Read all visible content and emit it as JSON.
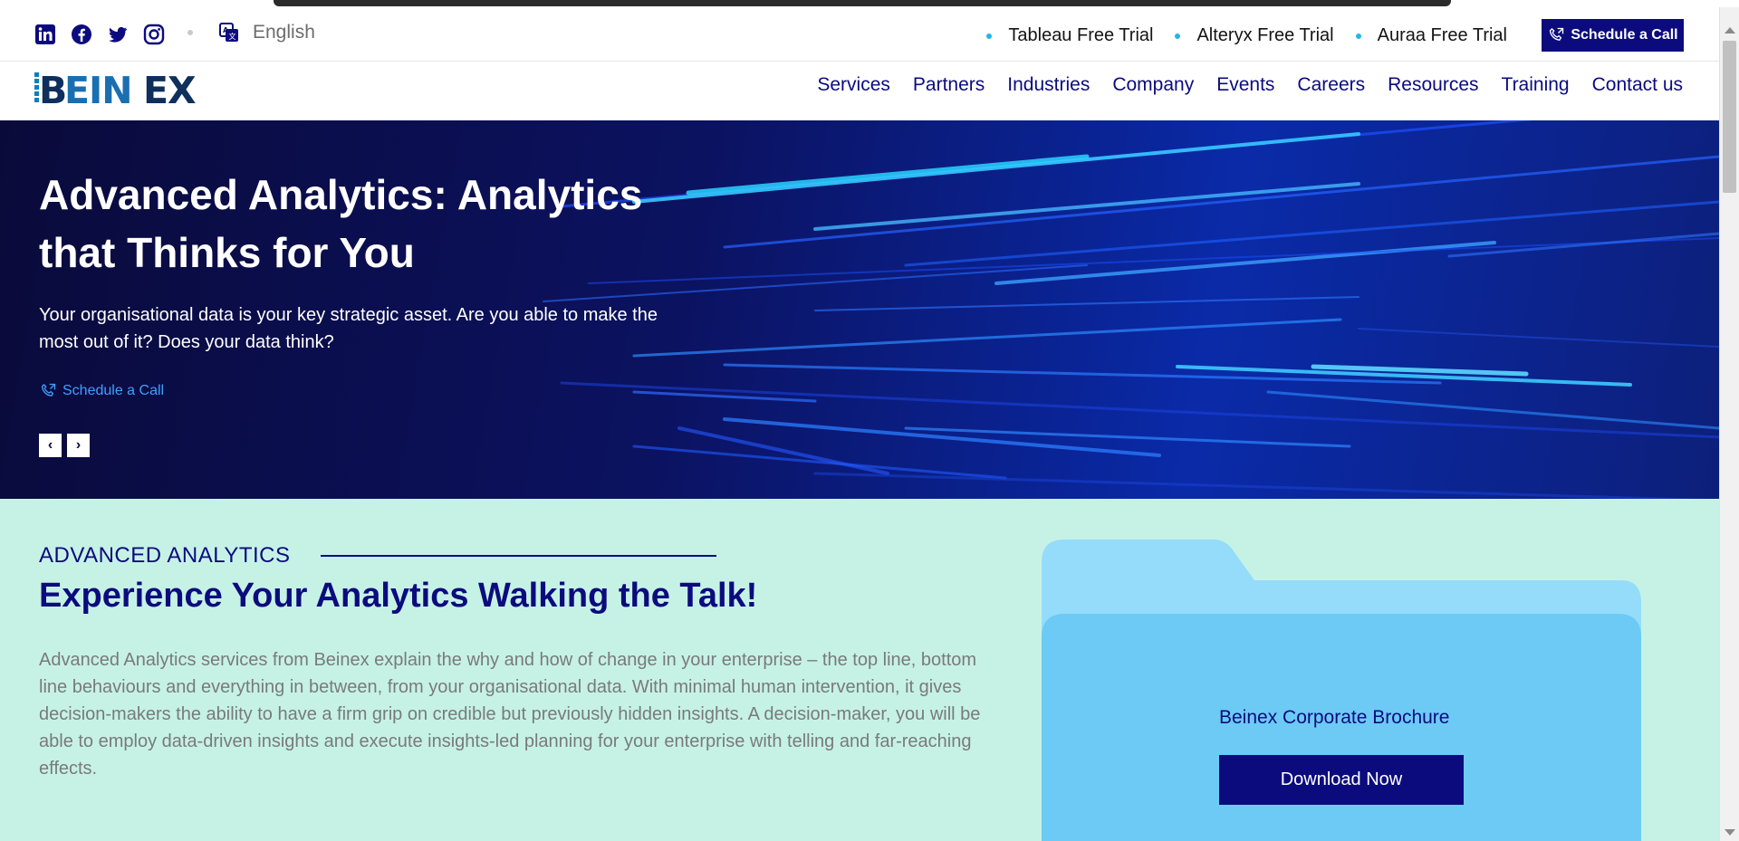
{
  "topbar": {
    "language": "English",
    "trials": [
      "Tableau Free Trial",
      "Alteryx Free Trial",
      "Auraa Free Trial"
    ],
    "schedule_call": "Schedule a Call"
  },
  "brand": {
    "logo_text": "BEINEX"
  },
  "nav": [
    "Services",
    "Partners",
    "Industries",
    "Company",
    "Events",
    "Careers",
    "Resources",
    "Training",
    "Contact us"
  ],
  "hero": {
    "title": "Advanced Analytics: Analytics that Thinks for You",
    "subtitle": "Your organisational data is your key strategic asset. Are you able to make the most out of it? Does your data think?",
    "cta": "Schedule a Call",
    "prev": "‹",
    "next": "›"
  },
  "section": {
    "eyebrow": "ADVANCED ANALYTICS",
    "title": "Experience Your Analytics Walking the Talk!",
    "body": "Advanced Analytics services from Beinex explain the why and how of change in your enterprise – the top line, bottom line behaviours and everything in between, from your organisational data. With minimal human intervention, it gives decision-makers the ability to have a firm grip on credible but previously hidden insights. A decision-maker, you will be able to employ data-driven insights and execute insights-led planning for your enterprise with telling and far-reaching effects."
  },
  "brochure": {
    "title": "Beinex Corporate Brochure",
    "button": "Download Now"
  },
  "colors": {
    "brand_navy": "#0c0b7e",
    "accent_cyan": "#22b7e6",
    "section_bg": "#c6f2e6",
    "folder_light": "#94dcfa",
    "folder_main": "#6ccaf5"
  }
}
